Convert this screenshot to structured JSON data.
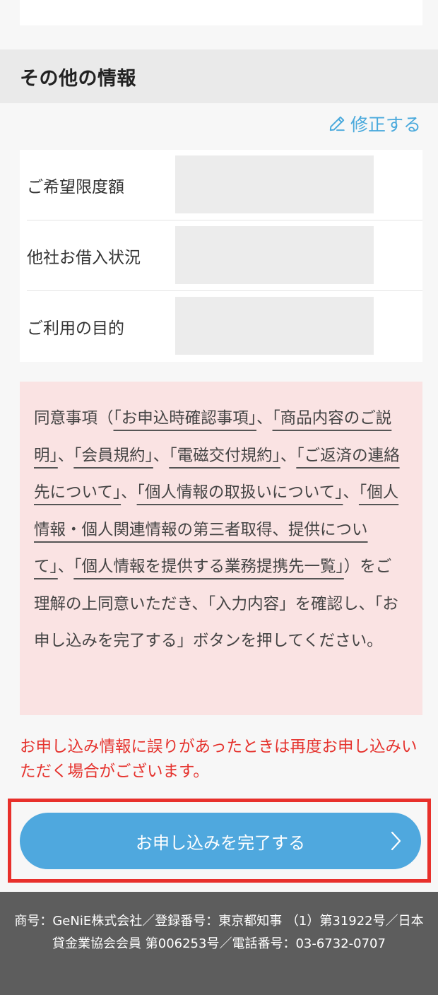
{
  "section": {
    "title": "その他の情報",
    "edit_label": "修正する"
  },
  "info_rows": [
    {
      "label": "ご希望限度額",
      "value": ""
    },
    {
      "label": "他社お借入状況",
      "value": ""
    },
    {
      "label": "ご利用の目的",
      "value": ""
    }
  ],
  "consent": {
    "t0": "同意事項（",
    "link1": "「お申込時確認事項」",
    "t1": "、",
    "link2": "「商品内容のご説明」",
    "t2": "、",
    "link3": "「会員規約」",
    "t3": "、",
    "link4": "「電磁交付規約」",
    "t4": "、",
    "link5": "「ご返済の連絡先について」",
    "t5": "、",
    "link6": "「個人情報の取扱いについて」",
    "t6": "、",
    "link7": "「個人情報・個人関連情報の第三者取得、提供について」",
    "t7": "、",
    "link8": "「個人情報を提供する業務提携先一覧」",
    "t8": "）をご理解の上同意いただき、「入力内容」を確認し、「お申し込みを完了する」ボタンを押してください。"
  },
  "warning": "お申し込み情報に誤りがあったときは再度お申し込みいただく場合がございます。",
  "submit_label": "お申し込みを完了する",
  "footer_text": "商号：GeNiE株式会社／登録番号：東京都知事 （1）第31922号／日本貸金業協会会員 第006253号／電話番号：03-6732-0707",
  "colors": {
    "accent": "#4fa8de",
    "link": "#49a9dc",
    "warning": "#e5322d",
    "highlight": "#e8302b",
    "consent_bg": "#fae3e3",
    "footer_bg": "#5d5d5d"
  },
  "icons": {
    "edit": "pencil-icon",
    "submit": "chevron-right-icon"
  }
}
